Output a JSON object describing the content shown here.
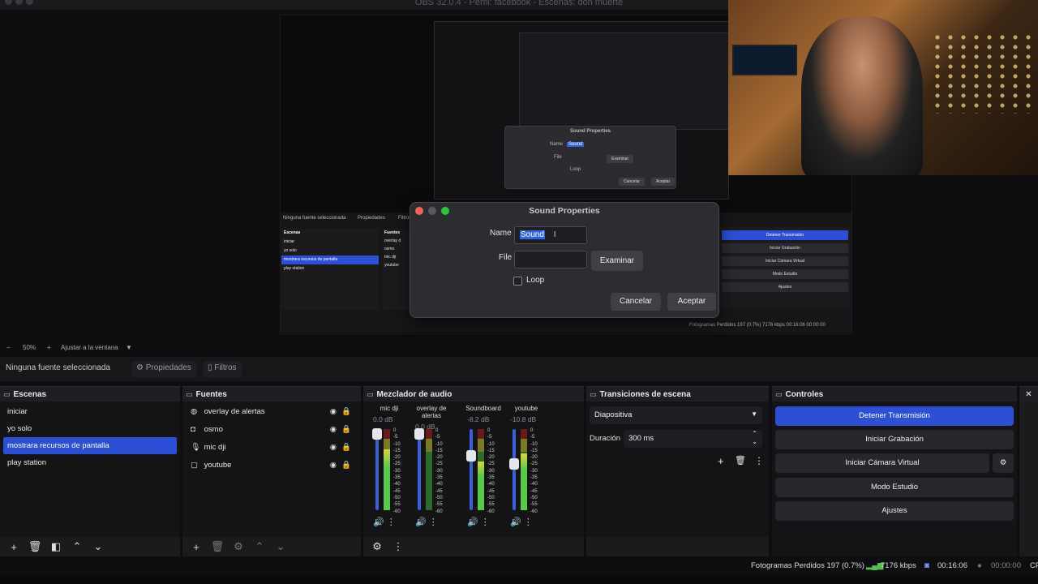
{
  "window": {
    "title": "OBS 32.0.4 - Perfil: facebook - Escenas: don muerte"
  },
  "preview": {
    "mini_dialog": {
      "title": "Sound Properties",
      "name_label": "Name",
      "name_value": "Sound",
      "file_label": "File",
      "browse": "Examinar",
      "loop": "Loop",
      "cancel": "Cancelar",
      "accept": "Aceptar"
    },
    "inner": {
      "no_source": "Ninguna fuente seleccionada",
      "props": "Propiedades",
      "filters": "Filtros",
      "scenes_title": "Escenas",
      "sources_title": "Fuentes",
      "scenes": [
        "iniciar",
        "yo solo",
        "mostrara recursos de pantalla",
        "play station"
      ],
      "sources": [
        "overlay d",
        "osmo",
        "mic dji",
        "youtube"
      ],
      "controls": [
        "Detener Transmisión",
        "Iniciar Grabación",
        "Iniciar Cámara Virtual",
        "Modo Estudio",
        "Ajustes"
      ],
      "status": "Fotogramas Perdidos 197 (0.7%)   7176 kbps   00:16:06   00:00:00",
      "zoom": "50%",
      "fit": "Ajustar a la ventana"
    }
  },
  "dialog": {
    "title": "Sound Properties",
    "name_label": "Name",
    "name_value": "Sound",
    "file_label": "File",
    "file_value": "",
    "browse": "Examinar",
    "loop_label": "Loop",
    "cancel": "Cancelar",
    "accept": "Aceptar"
  },
  "zoombar": {
    "minus": "−",
    "zoom": "50%",
    "plus": "+",
    "fit": "Ajustar a la ventana",
    "caret": "▼"
  },
  "toolbar": {
    "no_source": "Ninguna fuente seleccionada",
    "properties": "Propiedades",
    "filters": "Filtros"
  },
  "scenes": {
    "title": "Escenas",
    "items": [
      "iniciar",
      "yo solo",
      "mostrara recursos de pantalla",
      "play station"
    ],
    "selected_index": 2
  },
  "sources": {
    "title": "Fuentes",
    "items": [
      {
        "label": "overlay de alertas",
        "icon": "globe-icon"
      },
      {
        "label": "osmo",
        "icon": "camera-icon"
      },
      {
        "label": "mic dji",
        "icon": "microphone-icon"
      },
      {
        "label": "youtube",
        "icon": "window-icon"
      }
    ]
  },
  "mixer": {
    "title": "Mezclador de audio",
    "scale": [
      "0",
      "-5",
      "-10",
      "-15",
      "-20",
      "-25",
      "-30",
      "-35",
      "-40",
      "-45",
      "-50",
      "-55",
      "-60"
    ],
    "channels": [
      {
        "name": "mic dji",
        "db": "0.0 dB",
        "fader": 0.97,
        "level": 0.75
      },
      {
        "name": "overlay de alertas",
        "db": "0.0 dB",
        "fader": 0.97,
        "level": 0.0
      },
      {
        "name": "Soundboard",
        "db": "-8.2 dB",
        "fader": 0.7,
        "level": 0.6
      },
      {
        "name": "youtube",
        "db": "-10.8 dB",
        "fader": 0.6,
        "level": 0.7
      }
    ]
  },
  "transitions": {
    "title": "Transiciones de escena",
    "selected": "Diapositiva",
    "duration_label": "Duración",
    "duration_value": "300 ms"
  },
  "controls": {
    "title": "Controles",
    "stop_stream": "Detener Transmisión",
    "start_record": "Iniciar Grabación",
    "start_virtual_cam": "Iniciar Cámara Virtual",
    "studio_mode": "Modo Estudio",
    "settings": "Ajustes"
  },
  "status": {
    "dropped": "Fotogramas Perdidos 197 (0.7%)",
    "bitrate": "7176 kbps",
    "stream_time": "00:16:06",
    "record_time": "00:00:00",
    "cpu": "CP"
  },
  "colors": {
    "accent": "#2c4fd6",
    "panel": "#1b1b1e",
    "background": "#0e0e10"
  }
}
